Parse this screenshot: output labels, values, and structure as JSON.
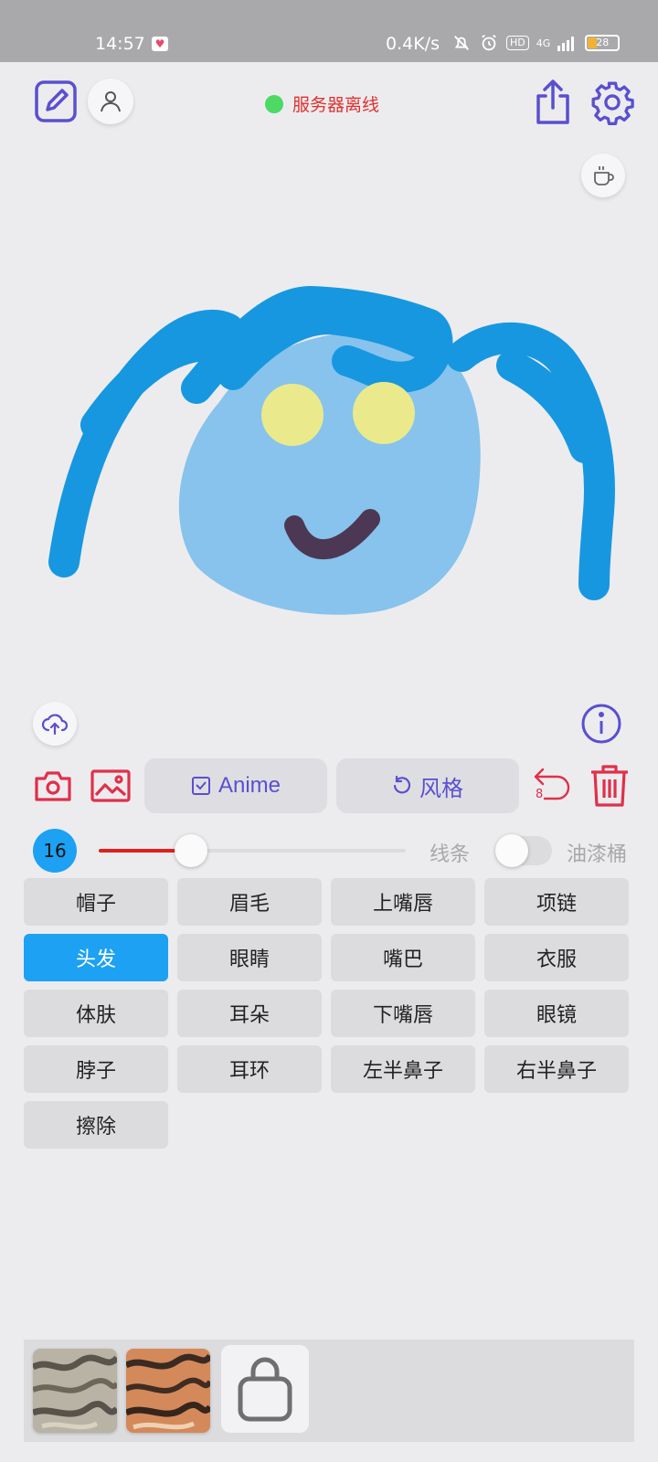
{
  "status_bar": {
    "time": "14:57",
    "network_speed": "0.4K/s",
    "hd_label": "HD",
    "network_type": "4G",
    "battery_level": "28"
  },
  "header": {
    "server_status": "服务器离线",
    "server_status_color": "#4cd964"
  },
  "colors": {
    "accent": "#5a4fcf",
    "danger": "#e0304a",
    "active_blue": "#1da1f2",
    "brush_color": "#e0201e"
  },
  "toolbar": {
    "anime_label": "Anime",
    "style_label": "风格",
    "undo_count": "8"
  },
  "brush": {
    "size": "16",
    "size_value": 16,
    "slider_fraction": 0.3,
    "line_label": "线条",
    "bucket_label": "油漆桶",
    "bucket_enabled": false
  },
  "categories": [
    {
      "label": "帽子",
      "active": false
    },
    {
      "label": "眉毛",
      "active": false
    },
    {
      "label": "上嘴唇",
      "active": false
    },
    {
      "label": "项链",
      "active": false
    },
    {
      "label": "头发",
      "active": true
    },
    {
      "label": "眼睛",
      "active": false
    },
    {
      "label": "嘴巴",
      "active": false
    },
    {
      "label": "衣服",
      "active": false
    },
    {
      "label": "体肤",
      "active": false
    },
    {
      "label": "耳朵",
      "active": false
    },
    {
      "label": "下嘴唇",
      "active": false
    },
    {
      "label": "眼镜",
      "active": false
    },
    {
      "label": "脖子",
      "active": false
    },
    {
      "label": "耳环",
      "active": false
    },
    {
      "label": "左半鼻子",
      "active": false
    },
    {
      "label": "右半鼻子",
      "active": false
    },
    {
      "label": "擦除",
      "active": false
    }
  ],
  "icons": {
    "edit": "edit-icon",
    "profile": "profile-icon",
    "share": "share-icon",
    "settings": "gear-icon",
    "coffee": "coffee-icon",
    "upload": "cloud-upload-icon",
    "info": "info-icon",
    "camera": "camera-icon",
    "gallery": "image-icon",
    "undo": "undo-icon",
    "delete": "trash-icon",
    "shop": "shopping-bag-icon"
  }
}
